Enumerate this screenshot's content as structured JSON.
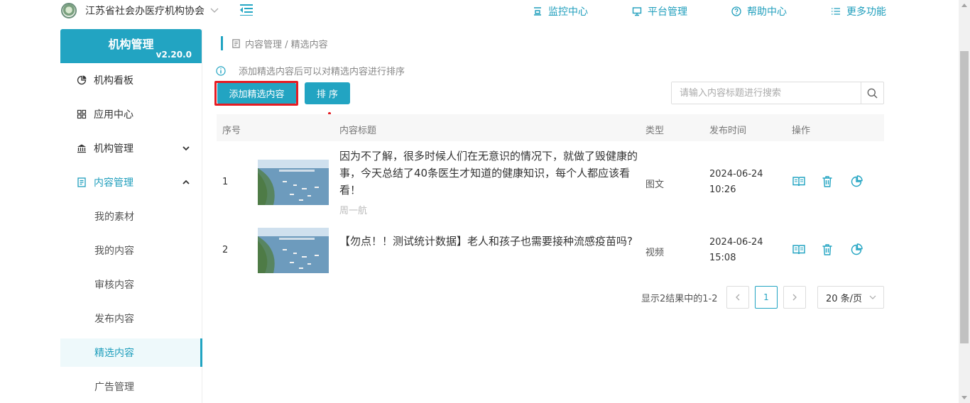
{
  "header": {
    "org_name": "江苏省社会办医疗机构协会",
    "nav": [
      {
        "label": "监控中心",
        "icon": "monitor-center-icon"
      },
      {
        "label": "平台管理",
        "icon": "desktop-icon"
      },
      {
        "label": "帮助中心",
        "icon": "help-circle-icon"
      },
      {
        "label": "更多功能",
        "icon": "list-icon"
      }
    ]
  },
  "sidebar": {
    "title": "机构管理",
    "version": "v2.20.0",
    "items": [
      {
        "label": "机构看板",
        "icon": "pie-chart-icon"
      },
      {
        "label": "应用中心",
        "icon": "grid-icon"
      },
      {
        "label": "机构管理",
        "icon": "bank-icon"
      },
      {
        "label": "内容管理",
        "icon": "document-icon"
      },
      {
        "label": "我的素材"
      },
      {
        "label": "我的内容"
      },
      {
        "label": "审核内容"
      },
      {
        "label": "发布内容"
      },
      {
        "label": "精选内容"
      },
      {
        "label": "广告管理"
      }
    ]
  },
  "breadcrumb": "内容管理 / 精选内容",
  "info_text": "添加精选内容后可以对精选内容进行排序",
  "toolbar": {
    "add_label": "添加精选内容",
    "sort_label": "排 序",
    "search_placeholder": "请输入内容标题进行搜索"
  },
  "table": {
    "columns": [
      "序号",
      "内容标题",
      "类型",
      "发布时间",
      "操作"
    ],
    "rows": [
      {
        "index": "1",
        "title": "因为不了解，很多时候人们在无意识的情况下，就做了毁健康的事，今天总结了40条医生才知道的健康知识，每个人都应该看看！",
        "author": "周一航",
        "type": "图文",
        "date": "2024-06-24",
        "time": "10:26"
      },
      {
        "index": "2",
        "title": "【勿点！！测试统计数据】老人和孩子也需要接种流感疫苗吗?",
        "author": "",
        "type": "视频",
        "date": "2024-06-24",
        "time": "15:08"
      }
    ]
  },
  "pagination": {
    "summary": "显示2结果中的1-2",
    "current_page": "1",
    "page_size": "20 条/页"
  },
  "colors": {
    "accent": "#22a4c2",
    "highlight": "#e51c23"
  }
}
